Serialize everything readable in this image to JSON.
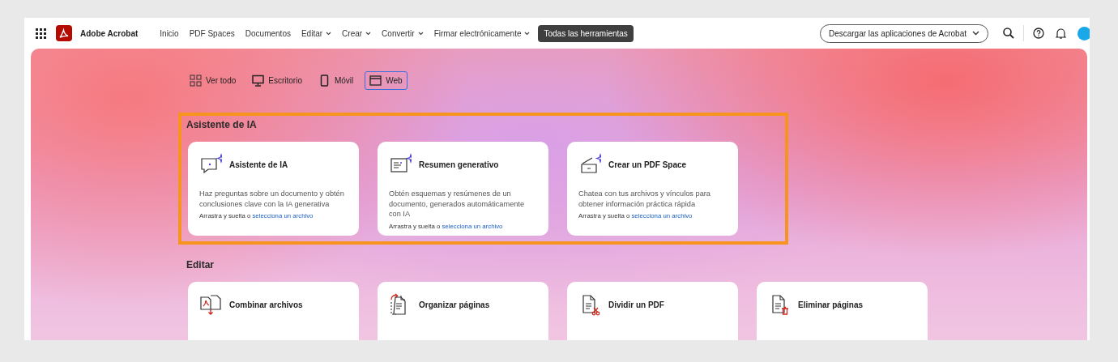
{
  "nav": {
    "app_name": "Adobe Acrobat",
    "items": [
      {
        "label": "Inicio",
        "dropdown": false
      },
      {
        "label": "PDF Spaces",
        "dropdown": false
      },
      {
        "label": "Documentos",
        "dropdown": false
      },
      {
        "label": "Editar",
        "dropdown": true
      },
      {
        "label": "Crear",
        "dropdown": true
      },
      {
        "label": "Convertir",
        "dropdown": true
      },
      {
        "label": "Firmar electrónicamente",
        "dropdown": true
      }
    ],
    "all_tools": "Todas las herramientas",
    "download": "Descargar las aplicaciones de Acrobat"
  },
  "view_filters": [
    {
      "label": "Ver todo",
      "kind": "grid",
      "selected": false
    },
    {
      "label": "Escritorio",
      "kind": "desktop",
      "selected": false
    },
    {
      "label": "Móvil",
      "kind": "phone",
      "selected": false
    },
    {
      "label": "Web",
      "kind": "browser",
      "selected": true
    }
  ],
  "sections": [
    {
      "title": "Asistente de IA",
      "highlighted": true,
      "cards": [
        {
          "kind": "chat",
          "title": "Asistente de IA",
          "description": "Haz preguntas sobre un documento y obtén conclusiones clave con la IA generativa",
          "drop_text": "Arrastra y suelta o",
          "link": "selecciona un archivo"
        },
        {
          "kind": "summary",
          "title": "Resumen generativo",
          "description": "Obtén esquemas y resúmenes de un documento, generados automáticamente con IA",
          "drop_text": "Arrastra y suelta o",
          "link": "selecciona un archivo"
        },
        {
          "kind": "space",
          "title": "Crear un PDF Space",
          "description": "Chatea con tus archivos y vínculos para obtener información práctica rápida",
          "drop_text": "Arrastra y suelta o",
          "link": "selecciona un archivo"
        }
      ]
    },
    {
      "title": "Editar",
      "highlighted": false,
      "cards": [
        {
          "kind": "combine",
          "title": "Combinar archivos"
        },
        {
          "kind": "organize",
          "title": "Organizar páginas"
        },
        {
          "kind": "split",
          "title": "Dividir un PDF"
        },
        {
          "kind": "delete",
          "title": "Eliminar páginas"
        }
      ]
    }
  ]
}
